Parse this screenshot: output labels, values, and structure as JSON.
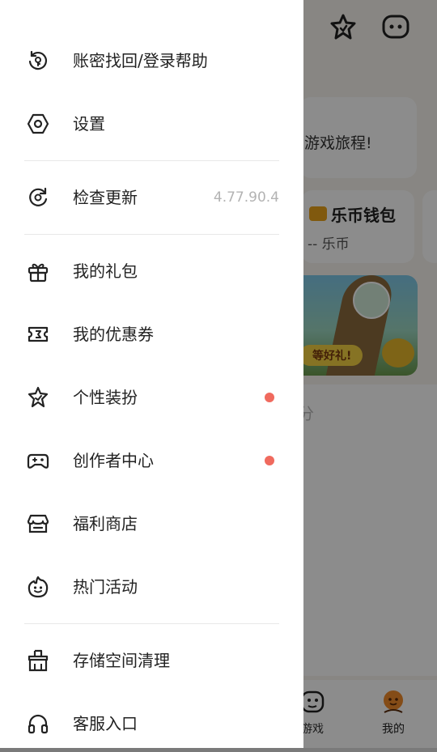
{
  "drawer": {
    "items": [
      {
        "id": "account-recovery",
        "icon": "refresh-lock-icon",
        "label": "账密找回/登录帮助"
      },
      {
        "id": "settings",
        "icon": "settings-hexagon-icon",
        "label": "设置"
      },
      {
        "id": "check-update",
        "icon": "update-icon",
        "label": "检查更新",
        "value": "4.77.90.4"
      },
      {
        "id": "gift-pack",
        "icon": "gift-icon",
        "label": "我的礼包"
      },
      {
        "id": "coupons",
        "icon": "ticket-icon",
        "label": "我的优惠券"
      },
      {
        "id": "personalize",
        "icon": "star-badge-icon",
        "label": "个性装扮",
        "badge": true
      },
      {
        "id": "creator-center",
        "icon": "gamepad-icon",
        "label": "创作者中心",
        "badge": true
      },
      {
        "id": "welfare-store",
        "icon": "store-icon",
        "label": "福利商店"
      },
      {
        "id": "hot-events",
        "icon": "flame-face-icon",
        "label": "热门活动"
      },
      {
        "id": "storage-clean",
        "icon": "broom-icon",
        "label": "存储空间清理"
      },
      {
        "id": "customer-service",
        "icon": "headset-icon",
        "label": "客服入口"
      }
    ]
  },
  "background": {
    "greeting_tail": "游戏旅程!",
    "wallet_title": "乐币钱包",
    "wallet_value": "-- 乐币",
    "banner_text": "等好礼!",
    "partial_text": "分",
    "tabs": [
      {
        "label": "游戏",
        "icon": "game-face-icon"
      },
      {
        "label": "我的",
        "icon": "mascot-icon"
      }
    ]
  },
  "colors": {
    "badge": "#f06a5e",
    "accent": "#f08a2a"
  }
}
